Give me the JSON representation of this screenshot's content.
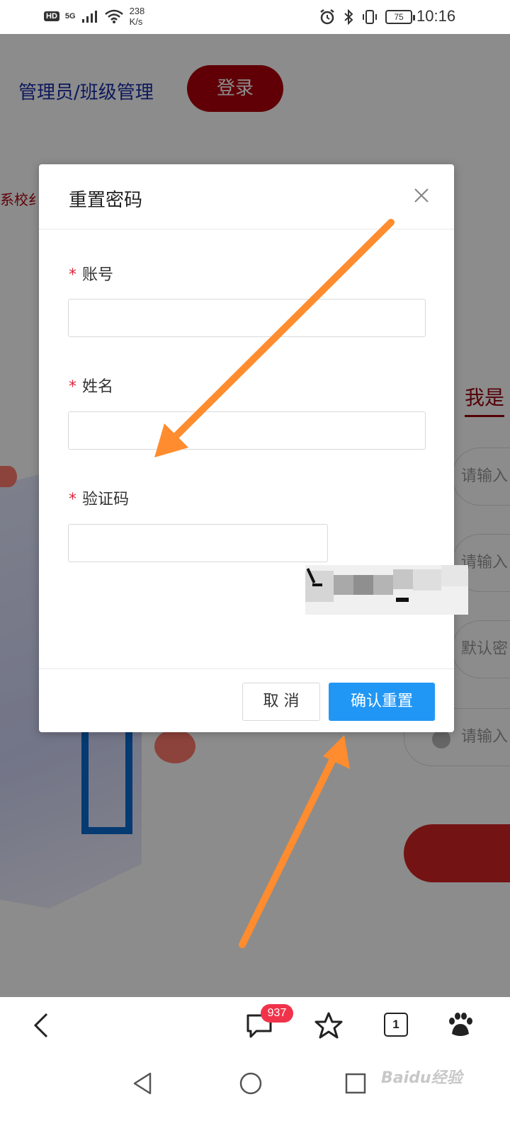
{
  "status_bar": {
    "hd": "HD",
    "network": "5G",
    "speed_value": "238",
    "speed_unit": "K/s",
    "battery": "75",
    "time": "10:16"
  },
  "background_page": {
    "admin_link": "管理员/班级管理",
    "login_button": "登录",
    "school_text": "系校纟",
    "role_tab": "我是",
    "input_placeholder_1": "请输入",
    "input_placeholder_2": "请输入",
    "input_placeholder_3": "默认密",
    "input_placeholder_4": "请输入"
  },
  "dialog": {
    "title": "重置密码",
    "required_mark": "*",
    "fields": [
      {
        "label": "账号",
        "value": ""
      },
      {
        "label": "姓名",
        "value": ""
      },
      {
        "label": "验证码",
        "value": ""
      }
    ],
    "cancel_button": "取 消",
    "confirm_button": "确认重置"
  },
  "browser_bar": {
    "comment_badge": "937",
    "tab_count": "1"
  },
  "watermark": "Baidu经验",
  "colors": {
    "primary_button": "#2197f5",
    "login_button": "#b0000c",
    "required_mark": "#e0243c",
    "annotation_arrow": "#ff8c2e",
    "badge": "#f0334a"
  }
}
